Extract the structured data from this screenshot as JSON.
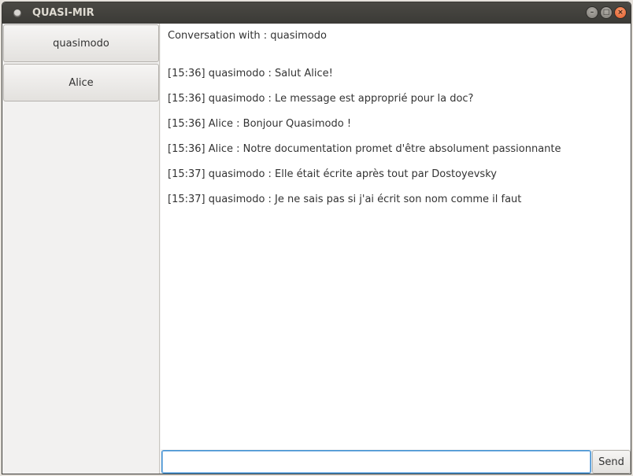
{
  "window": {
    "title": "QUASI-MIR",
    "controls": {
      "minimize": "–",
      "maximize": "□",
      "close": "×"
    }
  },
  "sidebar": {
    "contacts": [
      {
        "name": "quasimodo"
      },
      {
        "name": "Alice"
      }
    ]
  },
  "chat": {
    "header": "Conversation with : quasimodo",
    "messages": [
      "[15:36] quasimodo : Salut Alice!",
      "[15:36] quasimodo : Le message est approprié pour la doc?",
      "[15:36] Alice : Bonjour Quasimodo !",
      "[15:36] Alice : Notre documentation promet d'être absolument passionnante",
      "[15:37] quasimodo : Elle était écrite après tout par Dostoyevsky",
      "[15:37] quasimodo : Je ne sais pas si j'ai écrit son nom comme il faut"
    ]
  },
  "composer": {
    "input_value": "",
    "send_label": "Send"
  },
  "colors": {
    "titlebar": "#3b3a36",
    "close_button": "#e05b2b",
    "focus_ring": "#3d8fd1"
  }
}
